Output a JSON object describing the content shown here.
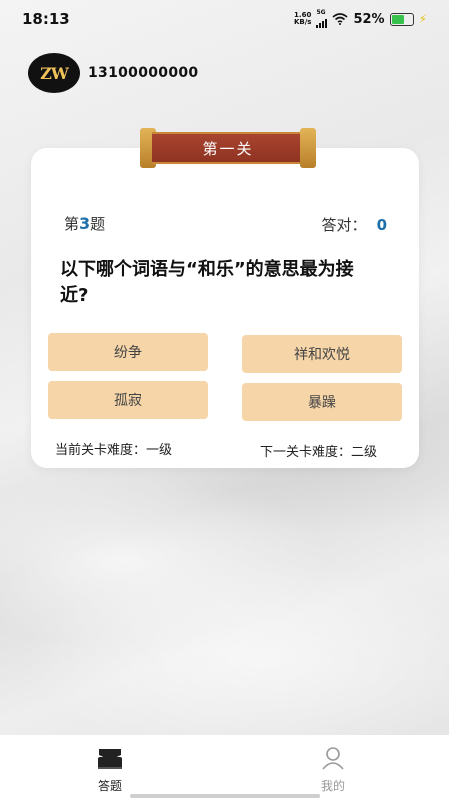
{
  "status_bar": {
    "time": "18:13",
    "net_speed_value": "1.60",
    "net_speed_unit": "KB/s",
    "network_type": "5G",
    "battery_percent": "52%"
  },
  "user": {
    "avatar_text": "ZW",
    "phone": "13100000000"
  },
  "level": {
    "title": "第一关"
  },
  "question": {
    "prefix": "第",
    "number": "3",
    "suffix": "题",
    "score_label": "答对：",
    "score_value": "0",
    "text": "以下哪个词语与“和乐”的意思最为接近?"
  },
  "options": [
    "纷争",
    "祥和欢悦",
    "孤寂",
    "暴躁"
  ],
  "difficulty": {
    "current": "当前关卡难度：一级",
    "next": "下一关卡难度：二级"
  },
  "tabs": {
    "answer_label": "答题",
    "mine_label": "我的"
  },
  "colors": {
    "banner": "#9a3a27",
    "option_bg": "#f6d5a8",
    "accent_number": "#1f6fa8"
  }
}
